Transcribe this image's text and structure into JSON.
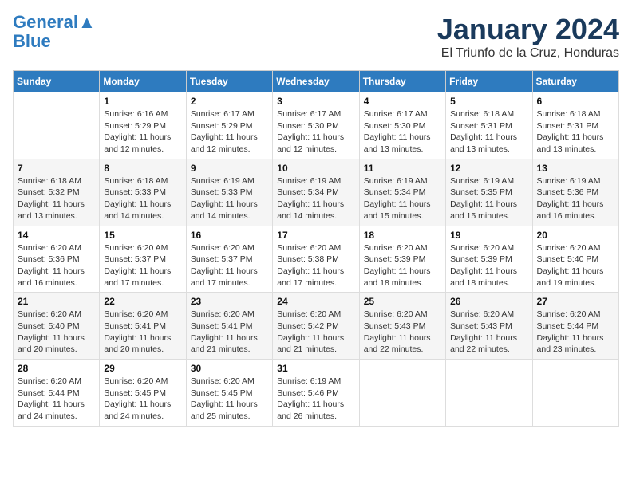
{
  "logo": {
    "line1": "General",
    "line2": "Blue"
  },
  "header": {
    "month": "January 2024",
    "location": "El Triunfo de la Cruz, Honduras"
  },
  "weekdays": [
    "Sunday",
    "Monday",
    "Tuesday",
    "Wednesday",
    "Thursday",
    "Friday",
    "Saturday"
  ],
  "weeks": [
    [
      {
        "day": "",
        "info": ""
      },
      {
        "day": "1",
        "info": "Sunrise: 6:16 AM\nSunset: 5:29 PM\nDaylight: 11 hours and 12 minutes."
      },
      {
        "day": "2",
        "info": "Sunrise: 6:17 AM\nSunset: 5:29 PM\nDaylight: 11 hours and 12 minutes."
      },
      {
        "day": "3",
        "info": "Sunrise: 6:17 AM\nSunset: 5:30 PM\nDaylight: 11 hours and 12 minutes."
      },
      {
        "day": "4",
        "info": "Sunrise: 6:17 AM\nSunset: 5:30 PM\nDaylight: 11 hours and 13 minutes."
      },
      {
        "day": "5",
        "info": "Sunrise: 6:18 AM\nSunset: 5:31 PM\nDaylight: 11 hours and 13 minutes."
      },
      {
        "day": "6",
        "info": "Sunrise: 6:18 AM\nSunset: 5:31 PM\nDaylight: 11 hours and 13 minutes."
      }
    ],
    [
      {
        "day": "7",
        "info": "Sunrise: 6:18 AM\nSunset: 5:32 PM\nDaylight: 11 hours and 13 minutes."
      },
      {
        "day": "8",
        "info": "Sunrise: 6:18 AM\nSunset: 5:33 PM\nDaylight: 11 hours and 14 minutes."
      },
      {
        "day": "9",
        "info": "Sunrise: 6:19 AM\nSunset: 5:33 PM\nDaylight: 11 hours and 14 minutes."
      },
      {
        "day": "10",
        "info": "Sunrise: 6:19 AM\nSunset: 5:34 PM\nDaylight: 11 hours and 14 minutes."
      },
      {
        "day": "11",
        "info": "Sunrise: 6:19 AM\nSunset: 5:34 PM\nDaylight: 11 hours and 15 minutes."
      },
      {
        "day": "12",
        "info": "Sunrise: 6:19 AM\nSunset: 5:35 PM\nDaylight: 11 hours and 15 minutes."
      },
      {
        "day": "13",
        "info": "Sunrise: 6:19 AM\nSunset: 5:36 PM\nDaylight: 11 hours and 16 minutes."
      }
    ],
    [
      {
        "day": "14",
        "info": "Sunrise: 6:20 AM\nSunset: 5:36 PM\nDaylight: 11 hours and 16 minutes."
      },
      {
        "day": "15",
        "info": "Sunrise: 6:20 AM\nSunset: 5:37 PM\nDaylight: 11 hours and 17 minutes."
      },
      {
        "day": "16",
        "info": "Sunrise: 6:20 AM\nSunset: 5:37 PM\nDaylight: 11 hours and 17 minutes."
      },
      {
        "day": "17",
        "info": "Sunrise: 6:20 AM\nSunset: 5:38 PM\nDaylight: 11 hours and 17 minutes."
      },
      {
        "day": "18",
        "info": "Sunrise: 6:20 AM\nSunset: 5:39 PM\nDaylight: 11 hours and 18 minutes."
      },
      {
        "day": "19",
        "info": "Sunrise: 6:20 AM\nSunset: 5:39 PM\nDaylight: 11 hours and 18 minutes."
      },
      {
        "day": "20",
        "info": "Sunrise: 6:20 AM\nSunset: 5:40 PM\nDaylight: 11 hours and 19 minutes."
      }
    ],
    [
      {
        "day": "21",
        "info": "Sunrise: 6:20 AM\nSunset: 5:40 PM\nDaylight: 11 hours and 20 minutes."
      },
      {
        "day": "22",
        "info": "Sunrise: 6:20 AM\nSunset: 5:41 PM\nDaylight: 11 hours and 20 minutes."
      },
      {
        "day": "23",
        "info": "Sunrise: 6:20 AM\nSunset: 5:41 PM\nDaylight: 11 hours and 21 minutes."
      },
      {
        "day": "24",
        "info": "Sunrise: 6:20 AM\nSunset: 5:42 PM\nDaylight: 11 hours and 21 minutes."
      },
      {
        "day": "25",
        "info": "Sunrise: 6:20 AM\nSunset: 5:43 PM\nDaylight: 11 hours and 22 minutes."
      },
      {
        "day": "26",
        "info": "Sunrise: 6:20 AM\nSunset: 5:43 PM\nDaylight: 11 hours and 22 minutes."
      },
      {
        "day": "27",
        "info": "Sunrise: 6:20 AM\nSunset: 5:44 PM\nDaylight: 11 hours and 23 minutes."
      }
    ],
    [
      {
        "day": "28",
        "info": "Sunrise: 6:20 AM\nSunset: 5:44 PM\nDaylight: 11 hours and 24 minutes."
      },
      {
        "day": "29",
        "info": "Sunrise: 6:20 AM\nSunset: 5:45 PM\nDaylight: 11 hours and 24 minutes."
      },
      {
        "day": "30",
        "info": "Sunrise: 6:20 AM\nSunset: 5:45 PM\nDaylight: 11 hours and 25 minutes."
      },
      {
        "day": "31",
        "info": "Sunrise: 6:19 AM\nSunset: 5:46 PM\nDaylight: 11 hours and 26 minutes."
      },
      {
        "day": "",
        "info": ""
      },
      {
        "day": "",
        "info": ""
      },
      {
        "day": "",
        "info": ""
      }
    ]
  ]
}
